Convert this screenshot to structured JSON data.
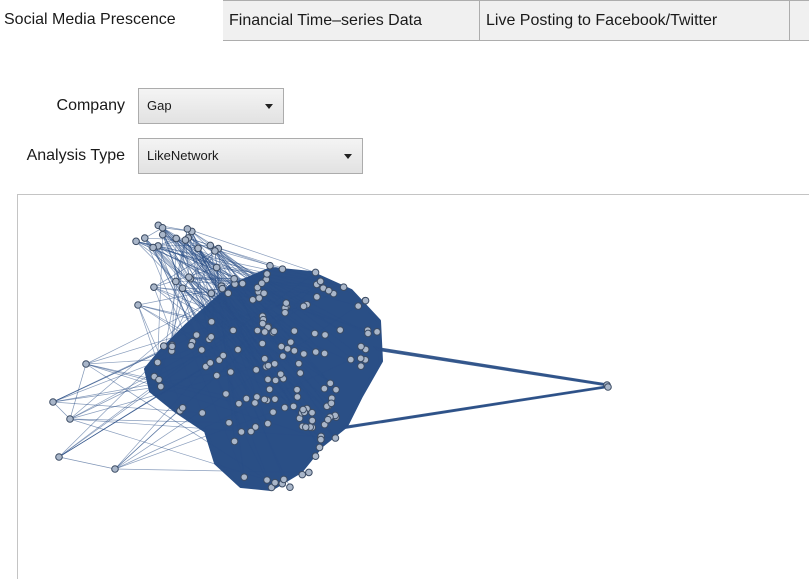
{
  "tabs": [
    {
      "label": "Social Media Prescence",
      "active": true
    },
    {
      "label": "Financial Time–series Data",
      "active": false
    },
    {
      "label": "Live Posting to Facebook/Twitter",
      "active": false
    }
  ],
  "form": {
    "company_label": "Company",
    "company_value": "Gap",
    "analysis_label": "Analysis Type",
    "analysis_value": "LikeNetwork"
  },
  "colors": {
    "accent": "#2a4f86",
    "node_fill": "#a9b6c9",
    "node_stroke": "#3b4b63"
  }
}
